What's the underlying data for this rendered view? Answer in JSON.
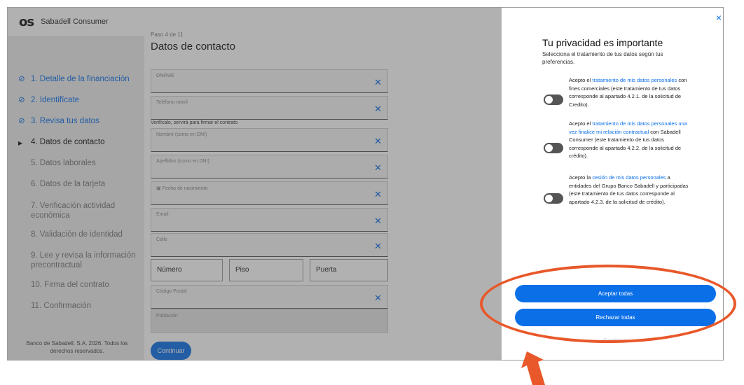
{
  "app": {
    "logo": "os",
    "brand": "Sabadell Consumer"
  },
  "sidebar": {
    "steps": [
      {
        "label": "1. Detalle de la financiación",
        "state": "done",
        "icon": "check-circle-icon"
      },
      {
        "label": "2. Identifícate",
        "state": "done",
        "icon": "check-circle-icon"
      },
      {
        "label": "3. Revisa tus datos",
        "state": "done",
        "icon": "check-circle-icon"
      },
      {
        "label": "4. Datos de contacto",
        "state": "active",
        "icon": "play-triangle-icon"
      },
      {
        "label": "5. Datos laborales",
        "state": "pending"
      },
      {
        "label": "6. Datos de la tarjeta",
        "state": "pending"
      },
      {
        "label": "7. Verificación actividad económica",
        "state": "pending"
      },
      {
        "label": "8. Validación de identidad",
        "state": "pending"
      },
      {
        "label": "9. Lee y revisa la información precontractual",
        "state": "pending"
      },
      {
        "label": "10. Firma del contrato",
        "state": "pending"
      },
      {
        "label": "11. Confirmación",
        "state": "pending"
      }
    ],
    "copyright": "Banco de Sabadell, S.A. 2026. Todos los derechos reservados."
  },
  "form": {
    "step_number": "Paso 4 de 11",
    "title": "Datos de contacto",
    "fields": {
      "dni": "DNI/NIE",
      "phone": "Teléfono móvil",
      "phone_helper": "Verifícalo, servirá para firmar el contrato",
      "name": "Nombre (como en DNI)",
      "surname": "Apellidos (como en DNI)",
      "birthdate": "Fecha de nacimiento",
      "email": "Email",
      "street": "Calle",
      "number": "Número",
      "floor": "Piso",
      "door": "Puerta",
      "postal_code": "Código Postal",
      "town": "Población"
    },
    "continue_label": "Continuar"
  },
  "privacy": {
    "close_icon": "×",
    "title": "Tu privacidad es importante",
    "subtitle": "Selecciona el tratamiento de tus datos según tus preferencias.",
    "consents": [
      {
        "pre": "Acepto el ",
        "link": "tratamiento de mis datos personales",
        "post": " con fines comerciales (este tratamiento de tus datos corresponde al apartado 4.2.1. de la solicitud de Credito).",
        "enabled": false
      },
      {
        "pre": "Acepto el ",
        "link": "tratamiento de mis datos personales una vez finalice mi relación contractual",
        "post": " con Sabadell Consumer (este tratamiento de tus datos corresponde al apartado 4.2.2. de la solicitud de crédito).",
        "enabled": false
      },
      {
        "pre": "Acepto la ",
        "link": "cesión de mis datos personales",
        "post": " a entidades del Grupo Banco Sabadell y participadas (este tratamiento de tus datos corresponde al apartado 4.2.3. de la solicitud de crédito).",
        "enabled": false
      }
    ],
    "accept_all": "Aceptar todas",
    "reject_all": "Rechazar todas",
    "continue": "Continuar"
  },
  "colors": {
    "accent": "#0b6fe8",
    "highlight": "#e8582a",
    "overlay": "rgba(70,70,70,0.42)"
  }
}
